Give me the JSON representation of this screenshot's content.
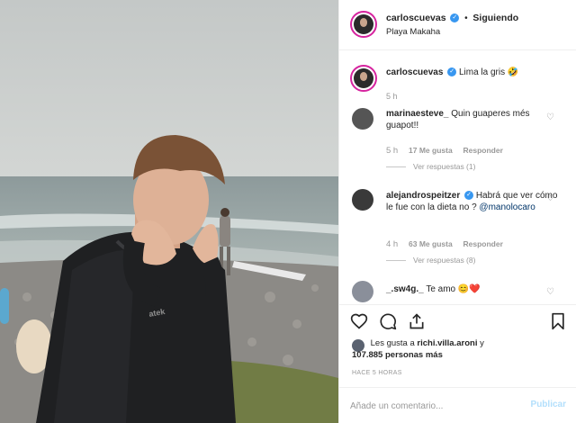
{
  "post": {
    "username": "carloscuevas",
    "verified_icon": "verified-badge-icon",
    "separator": "•",
    "follow_status": "Siguiendo",
    "location": "Playa Makaha"
  },
  "caption": {
    "username": "carloscuevas",
    "text": "Lima la gris",
    "emoji": "🤣",
    "time": "5 h"
  },
  "comments": [
    {
      "username": "marinaesteve_",
      "text": "Quin guaperes més guapot!!",
      "time": "5 h",
      "likes": "17 Me gusta",
      "reply_label": "Responder",
      "replies_label": "Ver respuestas (1)"
    },
    {
      "username": "alejandrospeitzer",
      "text": "Habrá que ver cómo le fue con la dieta no ?",
      "mention": "@manolocaro",
      "time": "4 h",
      "likes": "63 Me gusta",
      "reply_label": "Responder",
      "replies_label": "Ver respuestas (8)"
    },
    {
      "username": "_.sw4g._",
      "text": "Te amo",
      "emoji": "😊❤️"
    }
  ],
  "actions": {
    "like_icon": "heart-icon",
    "comment_icon": "comment-icon",
    "share_icon": "share-icon",
    "save_icon": "bookmark-icon"
  },
  "likes": {
    "prefix": "Les gusta a",
    "user": "richi.villa.aroni",
    "conj": "y",
    "count": "107.885 personas más"
  },
  "timestamp": "HACE 5 HORAS",
  "comment_box": {
    "placeholder": "Añade un comentario...",
    "post_label": "Publicar"
  },
  "colors": {
    "verified": "#3897f0",
    "story_ring": "#d6249f",
    "publish_disabled": "#b2dffc",
    "muted_text": "#999999"
  }
}
